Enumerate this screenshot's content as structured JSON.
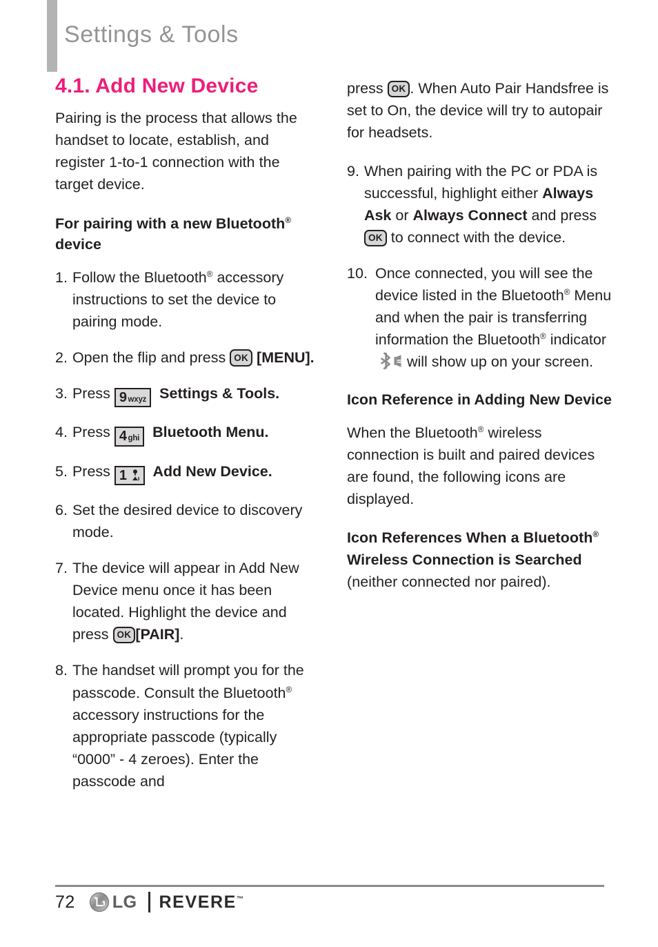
{
  "header": {
    "title": "Settings & Tools",
    "accent_color": "#ec1e79",
    "bar_color": "#b3b3b3",
    "title_color": "#949494"
  },
  "section": {
    "number_title": "4.1. Add New Device",
    "intro": "Pairing is the process that allows the handset to locate, establish, and register 1-to-1 connection with the target device."
  },
  "left_column": {
    "subheading_pairing": {
      "before_reg": "For pairing with a new Bluetooth",
      "reg": "®",
      "after_reg": " device"
    },
    "steps": [
      {
        "num": "1.",
        "text_parts": [
          "Follow the Bluetooth",
          "®",
          " accessory instructions to set the device to pairing mode."
        ]
      },
      {
        "num": "2.",
        "text_before": "Open the flip and press ",
        "key": "OK",
        "text_after": " [MENU]."
      },
      {
        "num": "3.",
        "text_before": "Press ",
        "keypad_digit": "9",
        "keypad_letters": "wxyz",
        "bold_after": "Settings & Tools",
        "text_end": "."
      },
      {
        "num": "4.",
        "text_before": "Press ",
        "keypad_digit": "4",
        "keypad_letters": "ghi",
        "bold_after": "Bluetooth Menu.",
        "text_end": ""
      },
      {
        "num": "5.",
        "text_before": "Press ",
        "keypad_digit": "1",
        "keypad_letters": "voicemail-symbol",
        "bold_after": "Add New Device",
        "text_end": "."
      },
      {
        "num": "6.",
        "text": "Set the desired device to discovery mode."
      },
      {
        "num": "7.",
        "text_before": "The device will appear in Add New Device menu once it has been located. Highlight the device and press ",
        "key": "OK",
        "bold_after": "[PAIR]",
        "text_end": "."
      },
      {
        "num": "8.",
        "text_parts": [
          "The handset will prompt you for the passcode. Consult the Bluetooth",
          "®",
          " accessory instructions for the appropriate passcode (typically “0000” - 4 zeroes). Enter the passcode and"
        ]
      }
    ]
  },
  "right_column": {
    "continuation": {
      "text_before": "press ",
      "key": "OK",
      "text_after": ". When Auto Pair Handsfree is set to On, the device will try to autopair for headsets."
    },
    "steps": [
      {
        "num": "9.",
        "part1": "When pairing with the PC or PDA is successful, highlight either ",
        "bold1": "Always Ask",
        "part2": " or ",
        "bold2": "Always Connect",
        "part3": " and press ",
        "key": "OK",
        "part4": " to connect with the device."
      },
      {
        "num": "10.",
        "part1": "Once connected, you will see the device listed in the Bluetooth",
        "reg1": "®",
        "part2": " Menu and when the pair is transferring information the Bluetooth",
        "reg2": "®",
        "part3": " indicator ",
        "icon": "bluetooth-transfer-indicator",
        "part4": " will show up on your screen."
      }
    ],
    "icon_reference_heading": "Icon Reference in Adding New Device",
    "icon_reference_body": {
      "before_reg": "When the Bluetooth",
      "reg": "®",
      "after_reg": " wireless connection is built and paired devices are found, the following icons are displayed."
    },
    "searched_heading": {
      "bold1": "Icon References When a Bluetooth",
      "reg": "®",
      "bold2": " Wireless Connection is Searched",
      "normal": " (neither connected nor paired)."
    }
  },
  "footer": {
    "page_number": "72",
    "brand": "LG",
    "model": "REVERE",
    "trademark": "™"
  }
}
